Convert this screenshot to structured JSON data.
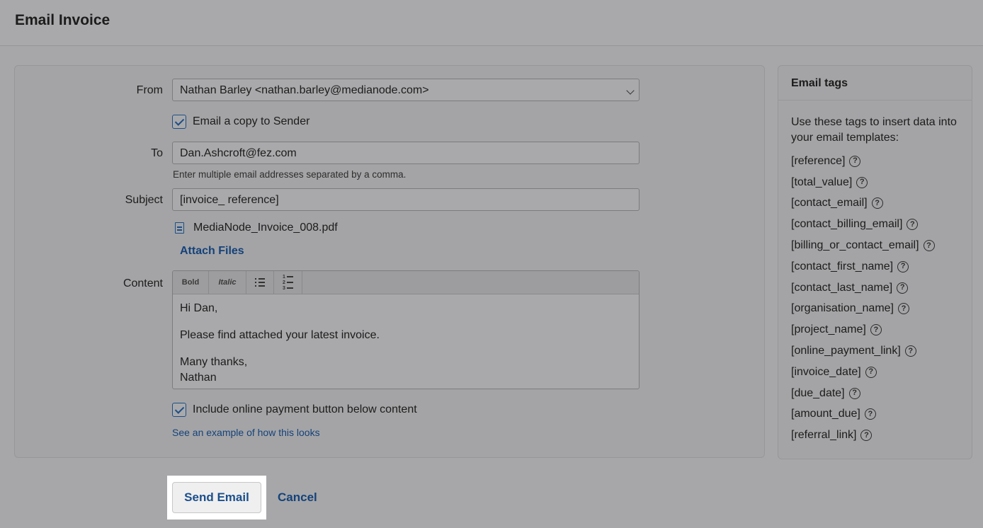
{
  "page": {
    "title": "Email Invoice"
  },
  "form": {
    "from_label": "From",
    "from_value": "Nathan Barley <nathan.barley@medianode.com>",
    "copy_sender_label": "Email a copy to Sender",
    "to_label": "To",
    "to_value": "Dan.Ashcroft@fez.com",
    "to_hint": "Enter multiple email addresses separated by a comma.",
    "subject_label": "Subject",
    "subject_value": "[invoice_ reference]",
    "attachment_name": "MediaNode_Invoice_008.pdf",
    "attach_files_label": "Attach Files",
    "content_label": "Content",
    "toolbar": {
      "bold": "Bold",
      "italic": "Italic"
    },
    "content": {
      "greeting": "Hi Dan,",
      "body": "Please find attached your latest invoice.",
      "signoff": "Many thanks,",
      "name": "Nathan"
    },
    "payment_button_label": "Include online payment button below content",
    "example_link": "See an example of how this looks"
  },
  "actions": {
    "send": "Send Email",
    "cancel": "Cancel"
  },
  "tags_panel": {
    "title": "Email tags",
    "intro": "Use these tags to insert data into your email templates:",
    "tags": [
      "[reference]",
      "[total_value]",
      "[contact_email]",
      "[contact_billing_email]",
      "[billing_or_contact_email]",
      "[contact_first_name]",
      "[contact_last_name]",
      "[organisation_name]",
      "[project_name]",
      "[online_payment_link]",
      "[invoice_date]",
      "[due_date]",
      "[amount_due]",
      "[referral_link]"
    ],
    "help_glyph": "?"
  }
}
